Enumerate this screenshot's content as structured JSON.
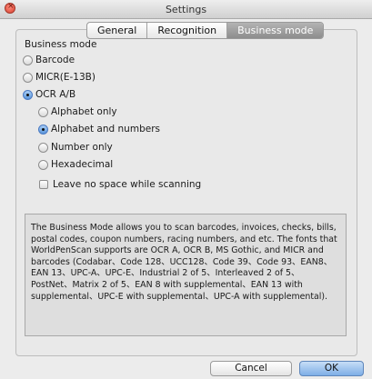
{
  "window": {
    "title": "Settings"
  },
  "tabs": [
    {
      "label": "General"
    },
    {
      "label": "Recognition"
    },
    {
      "label": "Business mode"
    }
  ],
  "business_mode": {
    "section_title": "Business mode",
    "options": [
      {
        "label": "Barcode",
        "selected": false
      },
      {
        "label": "MICR(E-13B)",
        "selected": false
      },
      {
        "label": "OCR A/B",
        "selected": true
      }
    ],
    "ocr_options": [
      {
        "label": "Alphabet only",
        "selected": false
      },
      {
        "label": "Alphabet and numbers",
        "selected": true
      },
      {
        "label": "Number only",
        "selected": false
      },
      {
        "label": "Hexadecimal",
        "selected": false
      }
    ],
    "leave_no_space": {
      "label": "Leave no space while scanning",
      "checked": false
    }
  },
  "description": "The Business Mode allows you to scan barcodes, invoices, checks, bills, postal codes, coupon numbers, racing numbers, and etc. The fonts that WorldPenScan supports are OCR A, OCR B, MS Gothic, and MICR and barcodes (Codabar、Code 128、UCC128、Code 39、Code 93、EAN8、EAN 13、UPC-A、UPC-E、Industrial 2 of 5、Interleaved 2 of 5、PostNet、Matrix 2 of 5、EAN 8 with supplemental、EAN 13 with supplemental、UPC-E with supplemental、UPC-A with supplemental).",
  "buttons": {
    "cancel": "Cancel",
    "ok": "OK"
  }
}
